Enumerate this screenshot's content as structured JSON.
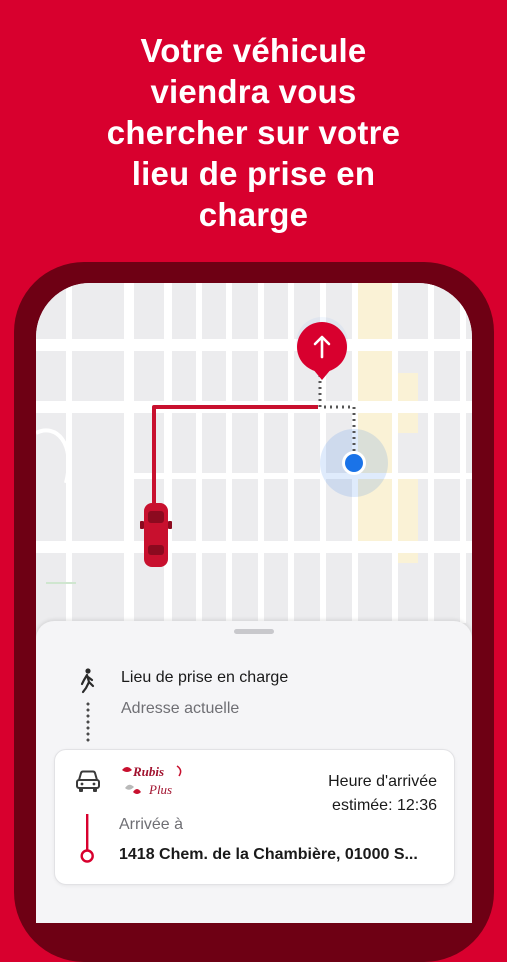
{
  "headline": {
    "line1": "Votre véhicule",
    "line2": "viendra vous",
    "line3": "chercher sur votre",
    "line4": "lieu de prise en",
    "line5": "charge"
  },
  "colors": {
    "background": "#D8002E",
    "phone_frame": "#6E0014",
    "route": "#C8102E",
    "location_dot": "#1A73E8"
  },
  "map": {
    "icons": [
      "navigation-arrow-icon",
      "current-location-icon",
      "car-icon"
    ]
  },
  "sheet": {
    "pickup_title": "Lieu de prise en charge",
    "pickup_subtitle": "Adresse actuelle",
    "card": {
      "logo_line1": "Rubis",
      "logo_line2": "Plus",
      "arrival_line1": "Heure d'arrivée",
      "arrival_line2": "estimée: 12:36",
      "destination_label": "Arrivée à",
      "destination_address": "1418 Chem. de la Chambière, 01000 S..."
    }
  }
}
